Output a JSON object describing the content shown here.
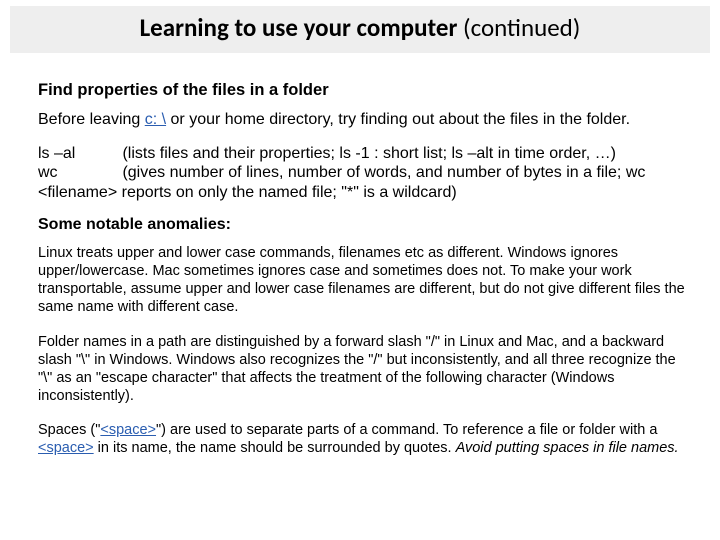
{
  "title": {
    "bold": "Learning to use your computer",
    "rest": " (continued)"
  },
  "section_heading": "Find properties of the files in a folder",
  "intro": {
    "t1": "Before leaving ",
    "link": "c: \\",
    "t2": " or your home directory, try finding out about the files in the folder."
  },
  "commands": {
    "row1": {
      "name": "ls –al",
      "desc": "(lists files and their properties; ls -1 : short list; ls –alt in time order, …)"
    },
    "row2": {
      "name": "wc",
      "desc": "(gives number of lines, number of words, and number of bytes in a file; wc <filename> reports on only the named file; \"*\" is a wildcard)"
    }
  },
  "anomalies_heading": "Some notable anomalies:",
  "anomaly1": "Linux treats upper and lower case commands, filenames etc as different. Windows ignores upper/lowercase. Mac sometimes ignores case and sometimes does not. To make your work transportable, assume upper and lower case filenames are different, but do not give different files the same name with different case.",
  "anomaly2": "Folder names in a path are distinguished by a forward slash \"/\" in Linux and Mac, and a backward slash \"\\\" in Windows. Windows also recognizes the \"/\" but inconsistently, and all three recognize the \"\\\" as an \"escape character\" that affects the treatment of the following character (Windows inconsistently).",
  "anomaly3": {
    "t1": "Spaces (\"",
    "s1": "<space>",
    "t2": "\") are used to separate parts of a command. To reference a file or folder with a ",
    "s2": "<space>",
    "t3": " in its name, the name should be surrounded by quotes. ",
    "italic": "Avoid putting spaces in file names."
  }
}
